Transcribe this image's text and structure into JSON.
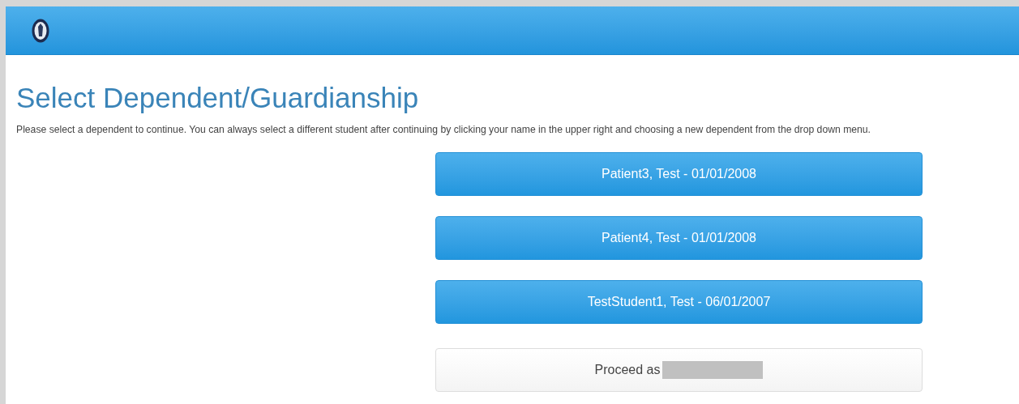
{
  "header": {
    "logo": {
      "kind": "seal"
    }
  },
  "page": {
    "title": "Select Dependent/Guardianship",
    "description": "Please select a dependent to continue. You can always select a different student after continuing by clicking your name in the upper right and choosing a new dependent from the drop down menu."
  },
  "dependents": [
    {
      "label": "Patient3, Test - 01/01/2008"
    },
    {
      "label": "Patient4, Test - 01/01/2008"
    },
    {
      "label": "TestStudent1, Test - 06/01/2007"
    }
  ],
  "proceed": {
    "label": "Proceed as",
    "name_redacted": true
  }
}
